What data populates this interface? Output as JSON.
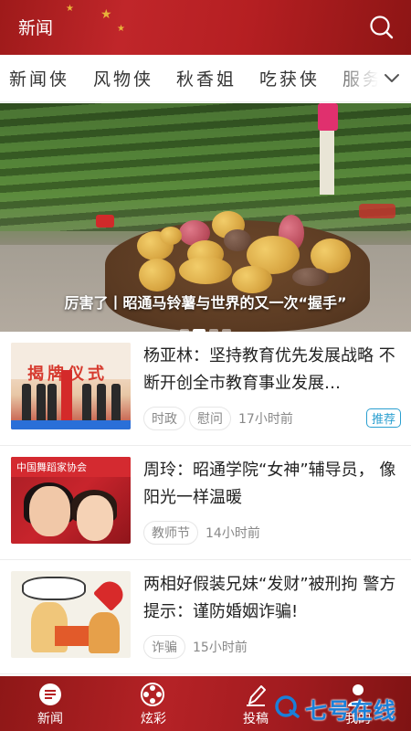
{
  "header": {
    "title": "新闻"
  },
  "tabs": [
    "新闻侠",
    "风物侠",
    "秋香姐",
    "吃获侠",
    "服务"
  ],
  "banner": {
    "caption": "厉害了丨昭通马铃薯与世界的又一次“握手”"
  },
  "news": [
    {
      "title": "杨亚林：坚持教育优先发展战略 不断开创全市教育事业发展…",
      "tags": [
        "时政",
        "慰问"
      ],
      "time": "17小时前",
      "badge": "推荐",
      "thumb_text": "揭牌仪式"
    },
    {
      "title": "周玲：昭通学院“女神”辅导员， 像阳光一样温暖",
      "tags": [
        "教师节"
      ],
      "time": "14小时前",
      "badge": "",
      "thumb_text": "中国舞蹈家协会"
    },
    {
      "title": "两相好假装兄妹“发财”被刑拘 警方提示：谨防婚姻诈骗!",
      "tags": [
        "诈骗"
      ],
      "time": "15小时前",
      "badge": ""
    }
  ],
  "bottom_nav": [
    {
      "label": "新闻",
      "icon": "news-icon"
    },
    {
      "label": "炫彩",
      "icon": "film-reel-icon"
    },
    {
      "label": "投稿",
      "icon": "pen-icon"
    },
    {
      "label": "我的",
      "icon": "person-icon"
    }
  ],
  "watermark": {
    "text": "七号在线"
  },
  "colors": {
    "brand_red": "#b51f22",
    "badge_blue": "#2a9fd0",
    "watermark_blue": "#1a7fd8"
  }
}
